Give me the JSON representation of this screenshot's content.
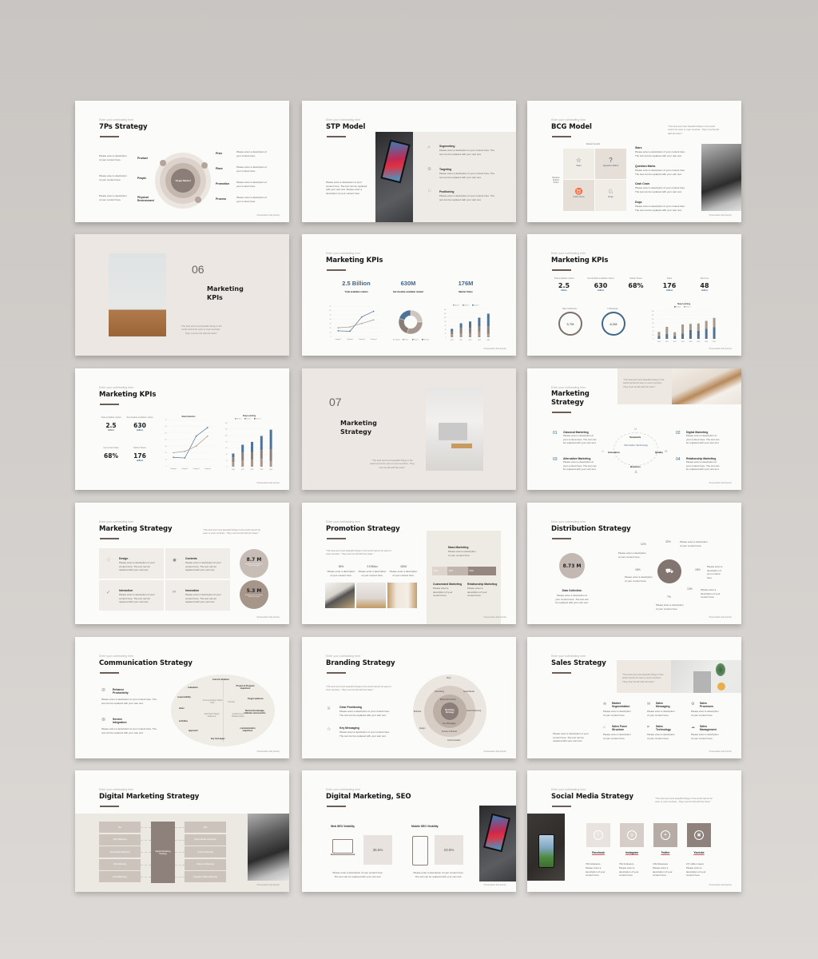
{
  "common": {
    "subtitle": "Enter your subheading here",
    "footer": "Presentation title (footer)",
    "desc_short": "Please enter a description of your content here.",
    "desc_long": "Please enter a description of your content here. The text can be replaced with your own text.",
    "quote": "\"The best and most beautiful things in the world cannot be seen or even touched - They must be felt with the heart.\""
  },
  "colors": {
    "background": "#cfcbc8",
    "slide": "#fbfbfa",
    "beige": "#ece7e2",
    "taupe": "#8b7e79",
    "light_taupe": "#c4b9b2",
    "accent_blue": "#3f6789",
    "title_underline": "#6b5e55"
  },
  "slides": [
    {
      "title": "7Ps Strategy",
      "center": "Target Market",
      "left": [
        "Product",
        "People",
        "Physical Environment"
      ],
      "right": [
        "Price",
        "Place",
        "Promotion",
        "Process"
      ]
    },
    {
      "title": "STP Model",
      "items": [
        {
          "label": "Segmenting",
          "icon": "search-icon"
        },
        {
          "label": "Targeting",
          "icon": "target-icon"
        },
        {
          "label": "Positioning",
          "icon": "flag-icon"
        }
      ],
      "left_text": "Please enter a description of your content here. The text can be replaced with your own text. Please enter a description of your content here."
    },
    {
      "title": "BCG Model",
      "axis_top": "Market Growth",
      "axis_left": "Relative Market Share",
      "cells": [
        "Stars",
        "Question Marks",
        "Cash Cows",
        "Dogs"
      ],
      "items": [
        "Stars",
        "Question Marks",
        "Cash Cows",
        "Dogs"
      ]
    },
    {
      "section_number": "06",
      "title_line1": "Marketing",
      "title_line2": "KPIs"
    },
    {
      "title": "Marketing KPIs",
      "kpis": [
        {
          "value": "2.5 Billion",
          "label": "Total available market"
        },
        {
          "value": "630M",
          "label": "Serviceable available market"
        },
        {
          "value": "176M",
          "label": "Market Share"
        }
      ],
      "donut_legend": [
        "Organic",
        "Direct",
        "Social",
        "Referral"
      ]
    },
    {
      "title": "Marketing KPIs",
      "stats": [
        {
          "label": "Total available market",
          "value": "2.5",
          "unit": "billion"
        },
        {
          "label": "Serviceable available market",
          "value": "630",
          "unit": "million"
        },
        {
          "label": "Market Share",
          "value": "68%",
          "unit": ""
        },
        {
          "label": "Sales",
          "value": "176",
          "unit": "million"
        },
        {
          "label": "Revenue",
          "value": "48",
          "unit": "million"
        }
      ],
      "rings": [
        {
          "label": "New customers",
          "value": "5,7M"
        },
        {
          "label": "In Revenue",
          "value": "8,2M"
        }
      ]
    },
    {
      "title": "Marketing KPIs",
      "stats": [
        {
          "label": "Total available market",
          "value": "2.5",
          "unit": "billion"
        },
        {
          "label": "Serviceable available market",
          "value": "630",
          "unit": "million"
        },
        {
          "label": "Conversion Rate",
          "value": "68%",
          "unit": ""
        },
        {
          "label": "Market Share",
          "value": "176",
          "unit": "million"
        }
      ]
    },
    {
      "section_number": "07",
      "title_line1": "Marketing",
      "title_line2": "Strategy"
    },
    {
      "title_line1": "Marketing",
      "title_line2": "Strategy",
      "items": [
        {
          "num": "01",
          "label": "Classical Marketing"
        },
        {
          "num": "02",
          "label": "Digital Marketing"
        },
        {
          "num": "03",
          "label": "Alternative Marketing"
        },
        {
          "num": "04",
          "label": "Relationship Marketing"
        }
      ],
      "cycle_center": "Information Technology",
      "cycle": [
        "Teamwork",
        "Quality",
        "Business",
        "Innovation"
      ]
    },
    {
      "title": "Marketing Strategy",
      "cells": [
        "Design",
        "Contents",
        "Interaction",
        "Innovation"
      ],
      "circles": [
        {
          "value": "8.7 M",
          "label": "Registered consumers in the last year"
        },
        {
          "value": "5.3 M",
          "label": "Registered consumers in the last year"
        }
      ]
    },
    {
      "title": "Promotion Strategy",
      "stats": [
        "68%",
        "3.5 Billion",
        "430M"
      ],
      "panel_items": [
        "Mass Marketing",
        "Customized Marketing",
        "Relationship Marketing"
      ],
      "segments": [
        "20%",
        "30%",
        "50%"
      ]
    },
    {
      "title": "Distribution Strategy",
      "circle_value": "8.73 M",
      "circle_caption": "Data Collection",
      "percentages": [
        "12%",
        "32%",
        "18%",
        "18%",
        "13%",
        "7%"
      ]
    },
    {
      "title": "Communication Strategy",
      "items": [
        "Enhance Productivity",
        "Service Integration"
      ],
      "ellipse_labels": [
        "Current situation",
        "evaluation",
        "Project & Program objectives",
        "responsibility",
        "Communication Work Plan",
        "Context",
        "Target audience",
        "when",
        "Desired knowledge, attitudes and practice",
        "Approach Target audience",
        "Audiences & Relationships",
        "activities",
        "communication objectives",
        "approach",
        "key messages"
      ]
    },
    {
      "title": "Branding Strategy",
      "items": [
        "Clear Positioning",
        "Key Messaging"
      ],
      "center": "Branding Strategy",
      "ring_labels": [
        "Story",
        "Advertising",
        "Social Media",
        "Brand Touch Point",
        "Clear Positioning",
        "Behavior",
        "Key Messaging",
        "Design",
        "Service & Product",
        "Communication"
      ]
    },
    {
      "title": "Sales Strategy",
      "items": [
        "Market Segmentation",
        "Sales Messaging",
        "Sales Processes",
        "Sales Force Structure",
        "Sales Technology",
        "Sales Management"
      ]
    },
    {
      "title": "Digital Marketing Strategy",
      "center": "Digital Marketing Strategy",
      "left": [
        "Site",
        "Video Marketing",
        "Social Media Marketing",
        "Viral Marketing",
        "Email Marketing"
      ],
      "right": [
        "SEO",
        "Paid & Mobile Advertising",
        "Content Marketing",
        "Influencer Marketing",
        "Integration Offline Marketing"
      ]
    },
    {
      "title": "Digital Marketing, SEO",
      "items": [
        {
          "label": "Web SEO Visibility",
          "value": "35.6%",
          "icon": "laptop-icon"
        },
        {
          "label": "Mobile SEO Visibility",
          "value": "23.5%",
          "icon": "phone-icon"
        }
      ]
    },
    {
      "title": "Social Media Strategy",
      "networks": [
        {
          "label": "Facebook",
          "icon": "facebook-icon",
          "stat": "70k Followers"
        },
        {
          "label": "Instagram",
          "icon": "instagram-icon",
          "stat": "70k Followers"
        },
        {
          "label": "Twitter",
          "icon": "twitter-icon",
          "stat": "4.5k Retweets"
        },
        {
          "label": "Youtube",
          "icon": "youtube-icon",
          "stat": "2.5 million views"
        }
      ]
    }
  ],
  "chart_data": [
    {
      "type": "line",
      "title": "Total available market",
      "categories": [
        "Category 1",
        "Category 2",
        "Category 3",
        "Category 4"
      ],
      "series": [
        {
          "name": "Series 1",
          "values": [
            13,
            12,
            45,
            58
          ],
          "color": "#4f7396"
        },
        {
          "name": "Series 2",
          "values": [
            20,
            22,
            30,
            38
          ],
          "color": "#a8978c"
        }
      ],
      "ylim": [
        0,
        70
      ]
    },
    {
      "type": "pie",
      "title": "Serviceable available market",
      "categories": [
        "Organic",
        "Direct",
        "Social",
        "Referral"
      ],
      "values": [
        25,
        30,
        25,
        20
      ]
    },
    {
      "type": "bar",
      "title": "Market Share",
      "categories": [
        "2020",
        "2021",
        "2022",
        "2023",
        "2024"
      ],
      "series": [
        {
          "name": "Series 1",
          "values": [
            15,
            20,
            22,
            25,
            18
          ]
        },
        {
          "name": "Series 2",
          "values": [
            15,
            25,
            25,
            28,
            38
          ]
        },
        {
          "name": "Series 3",
          "values": [
            12,
            25,
            32,
            45,
            62
          ]
        }
      ],
      "ylim": [
        0,
        140
      ]
    },
    {
      "type": "bar",
      "title": "Deep Learning",
      "categories": [
        "2020",
        "2021",
        "2022",
        "2023",
        "2024",
        "2025",
        "2026",
        "2027"
      ],
      "series": [
        {
          "name": "Series 1",
          "values": [
            15,
            25,
            15,
            27,
            45,
            40,
            50,
            58
          ]
        },
        {
          "name": "Series 2",
          "values": [
            20,
            35,
            18,
            45,
            30,
            37,
            40,
            47
          ]
        }
      ],
      "ylim": [
        0,
        140
      ]
    },
    {
      "type": "line",
      "title": "Data Collection",
      "categories": [
        "Category 1",
        "Category 2",
        "Category 3",
        "Category 4"
      ],
      "series": [
        {
          "name": "Series 1",
          "values": [
            13,
            12,
            45,
            58
          ]
        },
        {
          "name": "Series 2",
          "values": [
            20,
            22,
            30,
            45
          ]
        }
      ],
      "ylim": [
        0,
        70
      ]
    },
    {
      "type": "bar",
      "title": "Deep Learning",
      "categories": [
        "2020",
        "2021",
        "2022",
        "2023",
        "2024"
      ],
      "series": [
        {
          "name": "Series 1",
          "values": [
            15,
            20,
            22,
            25,
            18
          ]
        },
        {
          "name": "Series 2",
          "values": [
            15,
            25,
            25,
            28,
            38
          ]
        },
        {
          "name": "Series 3",
          "values": [
            12,
            25,
            32,
            45,
            62
          ]
        }
      ],
      "ylim": [
        0,
        140
      ]
    }
  ]
}
